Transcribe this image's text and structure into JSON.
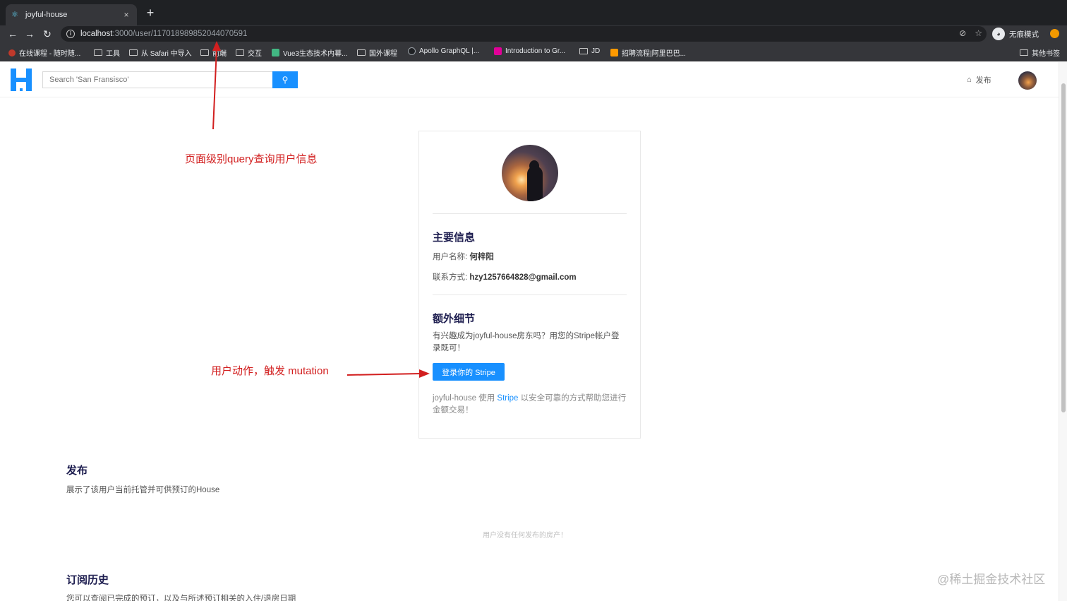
{
  "browser": {
    "tab_title": "joyful-house",
    "tab_close": "×",
    "new_tab": "+",
    "url_host": "localhost",
    "url_path": ":3000/user/117018989852044070591",
    "incognito_label": "无痕模式"
  },
  "bookmarks": [
    {
      "label": "在线课程 - 随时随...",
      "icon": "course-icon"
    },
    {
      "label": "工具",
      "icon": "folder-icon"
    },
    {
      "label": "从 Safari 中导入",
      "icon": "folder-icon"
    },
    {
      "label": "前端",
      "icon": "folder-icon"
    },
    {
      "label": "交互",
      "icon": "folder-icon"
    },
    {
      "label": "Vue3生态技术内幕...",
      "icon": "vue-icon"
    },
    {
      "label": "国外课程",
      "icon": "folder-icon"
    },
    {
      "label": "Apollo GraphQL |...",
      "icon": "apollo-icon"
    },
    {
      "label": "Introduction to Gr...",
      "icon": "graphql-icon"
    },
    {
      "label": "JD",
      "icon": "folder-icon"
    },
    {
      "label": "招聘流程|阿里巴巴...",
      "icon": "alibaba-icon"
    }
  ],
  "other_bookmarks": "其他书签",
  "header": {
    "search_placeholder": "Search 'San Fransisco'",
    "publish_label": "发布"
  },
  "card": {
    "main_title": "主要信息",
    "username_label": "用户名称: ",
    "username": "何梓阳",
    "contact_label": "联系方式: ",
    "contact": "hzy1257664828@gmail.com",
    "extra_title": "额外细节",
    "extra_desc": "有兴趣成为joyful-house房东吗？用您的Stripe帐户登录既可！",
    "stripe_button": "登录你的 Stripe",
    "footnote_pre": "joyful-house 使用 ",
    "footnote_link": "Stripe",
    "footnote_post": " 以安全可靠的方式帮助您进行金额交易！"
  },
  "annotations": {
    "query": "页面级别query查询用户信息",
    "mutation": "用户动作，触发 mutation"
  },
  "listings": {
    "title": "发布",
    "desc": "展示了该用户当前托管并可供预订的House",
    "empty": "用户没有任何发布的房产！"
  },
  "bookings": {
    "title": "订阅历史",
    "desc": "您可以查阅已完成的预订，以及与所述预订相关的入住/退房日期"
  },
  "watermark": "@稀土掘金技术社区",
  "colors": {
    "primary": "#1890ff",
    "annotation": "#d21f1f",
    "heading": "#1d1d4f"
  }
}
